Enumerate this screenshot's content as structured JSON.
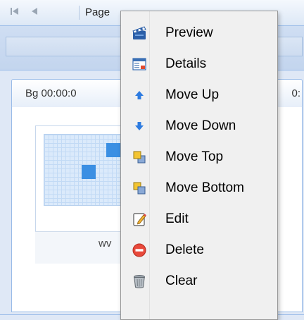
{
  "toolbar": {
    "first_icon": "first-page-icon",
    "prev_icon": "prev-page-icon",
    "page_label": "Page"
  },
  "slide_tab": {
    "label": "Bg  00:00:0",
    "right_text": "0:"
  },
  "thumbnail": {
    "caption": "wv"
  },
  "context_menu": {
    "items": [
      {
        "label": "Preview",
        "icon": "clapperboard-icon"
      },
      {
        "label": "Details",
        "icon": "details-window-icon"
      },
      {
        "label": "Move Up",
        "icon": "arrow-up-icon"
      },
      {
        "label": "Move Down",
        "icon": "arrow-down-icon"
      },
      {
        "label": "Move Top",
        "icon": "move-top-icon"
      },
      {
        "label": "Move Bottom",
        "icon": "move-bottom-icon"
      },
      {
        "label": "Edit",
        "icon": "edit-icon"
      },
      {
        "label": "Delete",
        "icon": "delete-icon"
      },
      {
        "label": "Clear",
        "icon": "trash-can-icon"
      }
    ]
  },
  "colors": {
    "panel": "#dfe8f6",
    "border": "#99bbe8",
    "menu_bg": "#f0f0f0",
    "accent": "#3b8fe3"
  }
}
